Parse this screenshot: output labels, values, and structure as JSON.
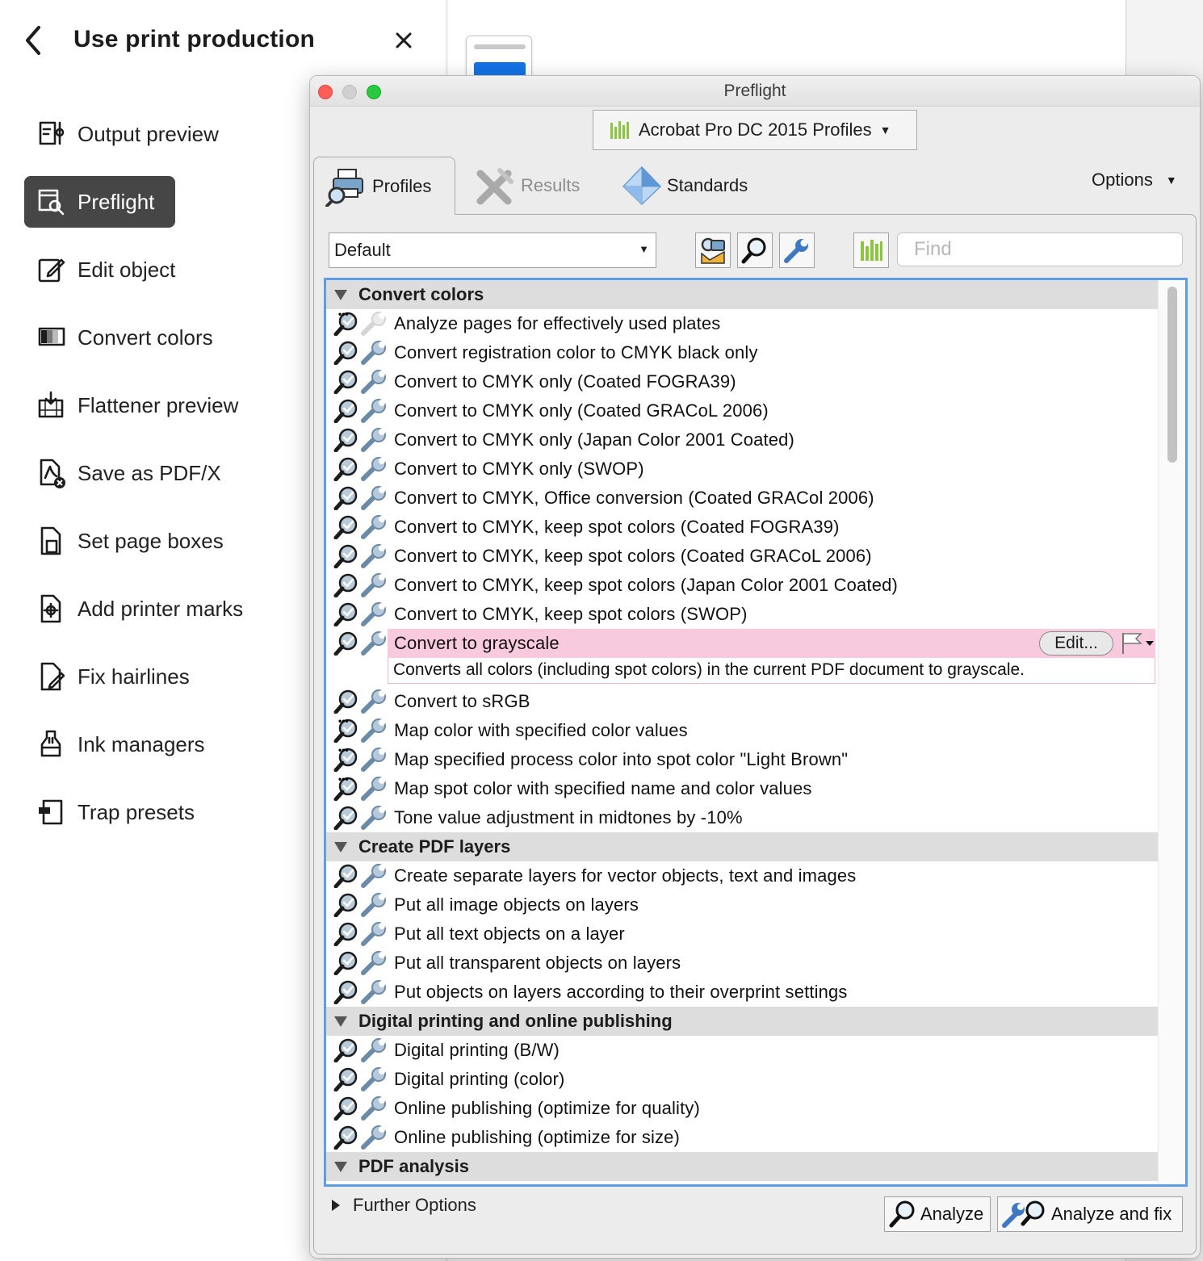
{
  "panel": {
    "title": "Use print production",
    "tools": [
      {
        "id": "output-preview",
        "label": "Output preview",
        "icon": "output-preview-icon",
        "active": false
      },
      {
        "id": "preflight",
        "label": "Preflight",
        "icon": "preflight-icon",
        "active": true
      },
      {
        "id": "edit-object",
        "label": "Edit object",
        "icon": "edit-object-icon",
        "active": false
      },
      {
        "id": "convert-colors",
        "label": "Convert colors",
        "icon": "convert-colors-icon",
        "active": false
      },
      {
        "id": "flattener-preview",
        "label": "Flattener preview",
        "icon": "flattener-preview-icon",
        "active": false
      },
      {
        "id": "save-as-pdfx",
        "label": "Save as PDF/X",
        "icon": "save-pdfx-icon",
        "active": false
      },
      {
        "id": "set-page-boxes",
        "label": "Set page boxes",
        "icon": "page-boxes-icon",
        "active": false
      },
      {
        "id": "add-printer-marks",
        "label": "Add printer marks",
        "icon": "printer-marks-icon",
        "active": false
      },
      {
        "id": "fix-hairlines",
        "label": "Fix hairlines",
        "icon": "fix-hairlines-icon",
        "active": false
      },
      {
        "id": "ink-managers",
        "label": "Ink managers",
        "icon": "ink-manager-icon",
        "active": false
      },
      {
        "id": "trap-presets",
        "label": "Trap presets",
        "icon": "trap-presets-icon",
        "active": false
      }
    ]
  },
  "window": {
    "title": "Preflight",
    "profile_set": "Acrobat Pro DC 2015 Profiles",
    "tabs": {
      "profiles": "Profiles",
      "results": "Results",
      "standards": "Standards"
    },
    "options": "Options",
    "filter": "Default",
    "find_placeholder": "Find",
    "further_options": "Further Options",
    "analyze": "Analyze",
    "analyze_fix": "Analyze and fix",
    "edit": "Edit..."
  },
  "groups": [
    {
      "name": "Convert colors",
      "items": [
        {
          "label": "Analyze pages for effectively used plates",
          "dots": true,
          "fix_disabled": true
        },
        {
          "label": "Convert registration color to CMYK black only"
        },
        {
          "label": "Convert to CMYK only (Coated FOGRA39)"
        },
        {
          "label": "Convert to CMYK only (Coated GRACoL 2006)"
        },
        {
          "label": "Convert to CMYK only (Japan Color 2001 Coated)"
        },
        {
          "label": "Convert to CMYK only (SWOP)"
        },
        {
          "label": "Convert to CMYK, Office conversion (Coated GRACol 2006)"
        },
        {
          "label": "Convert to CMYK, keep spot colors (Coated FOGRA39)"
        },
        {
          "label": "Convert to CMYK, keep spot colors (Coated GRACoL 2006)"
        },
        {
          "label": "Convert to CMYK, keep spot colors (Japan Color 2001 Coated)"
        },
        {
          "label": "Convert to CMYK, keep spot colors (SWOP)"
        },
        {
          "label": "Convert to grayscale",
          "selected": true,
          "description": "Converts all colors (including spot colors) in the current PDF document to grayscale."
        },
        {
          "label": "Convert to sRGB"
        },
        {
          "label": "Map color with specified color values",
          "dots": true
        },
        {
          "label": "Map specified process color into spot color \"Light Brown\"",
          "dots": true
        },
        {
          "label": "Map spot color with specified name and color values",
          "dots": true
        },
        {
          "label": "Tone value adjustment in midtones by -10%"
        }
      ]
    },
    {
      "name": "Create PDF layers",
      "items": [
        {
          "label": "Create separate layers for vector objects, text and images"
        },
        {
          "label": "Put all image objects on layers"
        },
        {
          "label": "Put all text objects on a layer"
        },
        {
          "label": "Put all transparent objects on layers"
        },
        {
          "label": "Put objects on layers according to their overprint settings"
        }
      ]
    },
    {
      "name": "Digital printing and online publishing",
      "items": [
        {
          "label": "Digital printing (B/W)"
        },
        {
          "label": "Digital printing (color)"
        },
        {
          "label": "Online publishing (optimize for quality)"
        },
        {
          "label": "Online publishing (optimize for size)"
        }
      ]
    },
    {
      "name": "PDF analysis",
      "items": []
    }
  ],
  "colors": {
    "accent": "#5b9ee6",
    "selection": "#f9c9de",
    "active_tool": "#464646"
  }
}
